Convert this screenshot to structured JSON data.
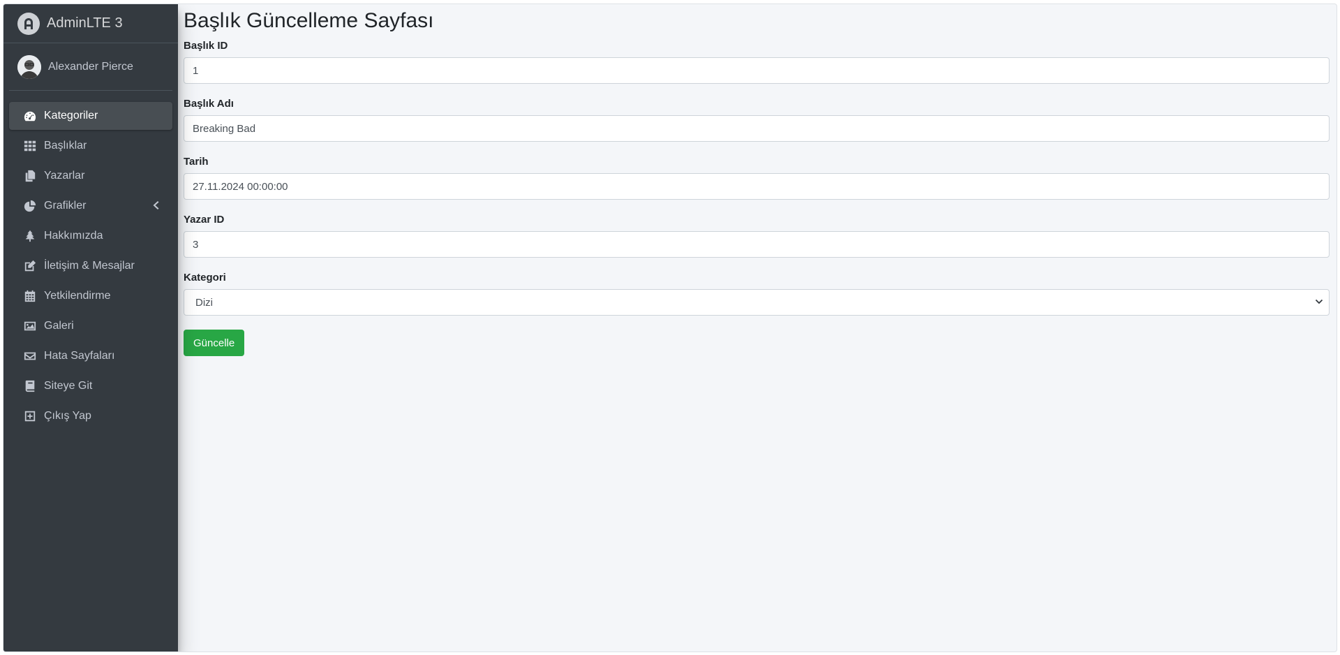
{
  "brand": {
    "name": "AdminLTE 3"
  },
  "user": {
    "name": "Alexander Pierce"
  },
  "sidebar": {
    "items": [
      {
        "label": "Kategoriler",
        "icon": "tachometer-icon",
        "active": true
      },
      {
        "label": "Başlıklar",
        "icon": "grid-icon"
      },
      {
        "label": "Yazarlar",
        "icon": "copy-icon"
      },
      {
        "label": "Grafikler",
        "icon": "pie-chart-icon",
        "has_submenu": true
      },
      {
        "label": "Hakkımızda",
        "icon": "tree-icon"
      },
      {
        "label": "İletişim & Mesajlar",
        "icon": "edit-icon"
      },
      {
        "label": "Yetkilendirme",
        "icon": "calendar-icon"
      },
      {
        "label": "Galeri",
        "icon": "image-icon"
      },
      {
        "label": "Hata Sayfaları",
        "icon": "envelope-icon"
      },
      {
        "label": "Siteye Git",
        "icon": "book-icon"
      },
      {
        "label": "Çıkış Yap",
        "icon": "plus-square-icon"
      }
    ]
  },
  "page": {
    "title": "Başlık Güncelleme Sayfası",
    "fields": {
      "baslik_id": {
        "label": "Başlık ID",
        "value": "1"
      },
      "baslik_adi": {
        "label": "Başlık Adı",
        "value": "Breaking Bad"
      },
      "tarih": {
        "label": "Tarih",
        "value": "27.11.2024 00:00:00"
      },
      "yazar_id": {
        "label": "Yazar ID",
        "value": "3"
      },
      "kategori": {
        "label": "Kategori",
        "selected": "Dizi"
      }
    },
    "submit_label": "Güncelle"
  },
  "colors": {
    "sidebar_bg": "#343a40",
    "content_bg": "#f4f6f9",
    "success": "#28a745"
  }
}
